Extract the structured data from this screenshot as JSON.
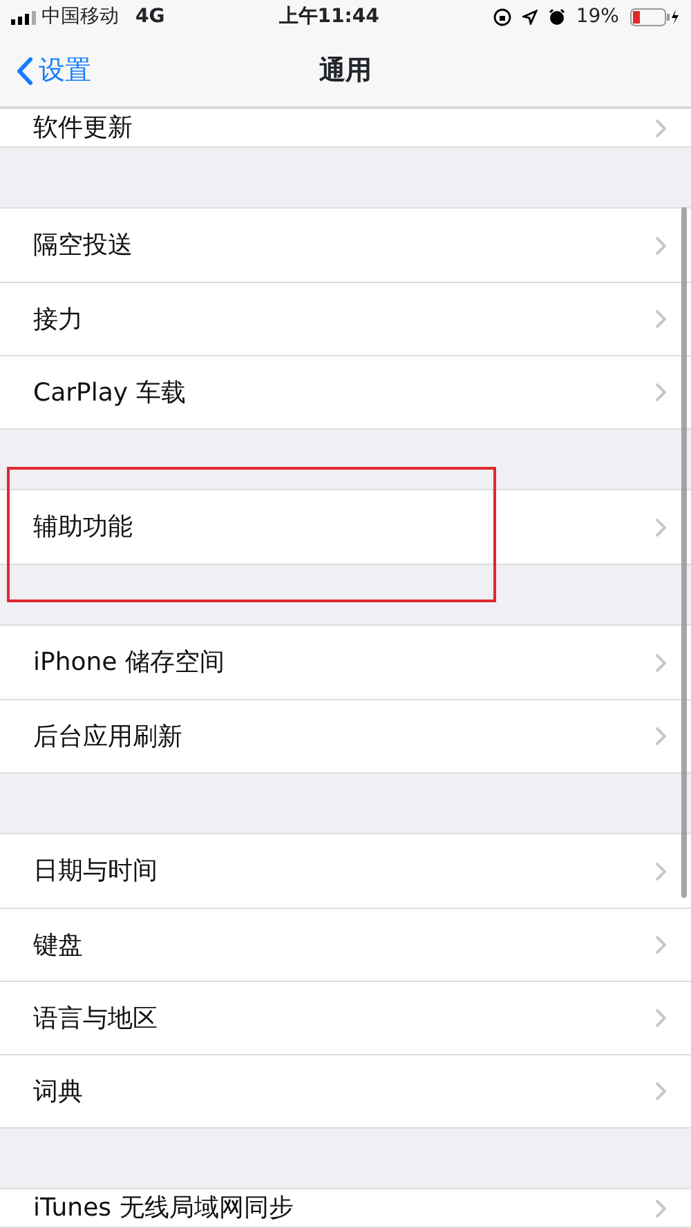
{
  "status_bar": {
    "carrier": "中国移动",
    "network": "4G",
    "time": "上午11:44",
    "battery": "19%"
  },
  "nav": {
    "back": "设置",
    "title": "通用"
  },
  "groups": [
    {
      "items": [
        {
          "label": "软件更新",
          "highlighted": false
        }
      ]
    },
    {
      "items": [
        {
          "label": "隔空投送",
          "highlighted": false
        },
        {
          "label": "接力",
          "highlighted": false
        },
        {
          "label": "CarPlay 车载",
          "highlighted": false
        }
      ]
    },
    {
      "items": [
        {
          "label": "辅助功能",
          "highlighted": true
        }
      ]
    },
    {
      "items": [
        {
          "label": "iPhone 储存空间",
          "highlighted": false
        },
        {
          "label": "后台应用刷新",
          "highlighted": false
        }
      ]
    },
    {
      "items": [
        {
          "label": "日期与时间",
          "highlighted": false
        },
        {
          "label": "键盘",
          "highlighted": false
        },
        {
          "label": "语言与地区",
          "highlighted": false
        },
        {
          "label": "词典",
          "highlighted": false
        }
      ]
    },
    {
      "items": [
        {
          "label": "iTunes 无线局域网同步",
          "highlighted": false
        }
      ]
    }
  ]
}
